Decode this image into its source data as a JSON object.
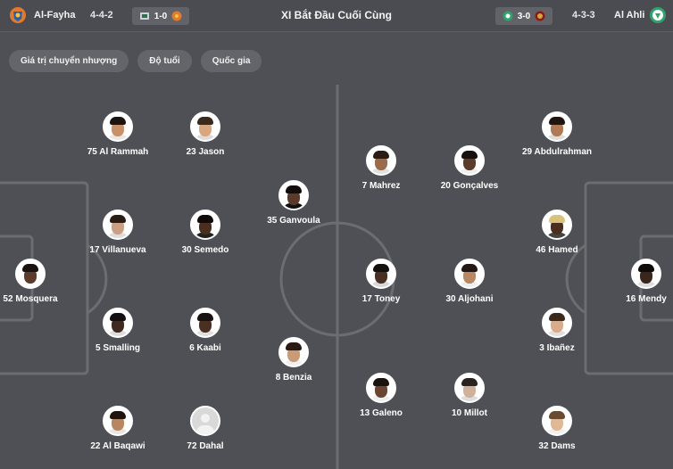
{
  "header": {
    "title": "XI Bắt Đầu Cuối Cùng",
    "home": {
      "name": "Al-Fayha",
      "formation": "4-4-2",
      "last_score": "1-0"
    },
    "away": {
      "name": "Al Ahli",
      "formation": "4-3-3",
      "last_score": "3-0"
    }
  },
  "filters": [
    {
      "label": "Giá trị chuyển nhượng"
    },
    {
      "label": "Độ tuổi"
    },
    {
      "label": "Quốc gia"
    }
  ],
  "colors": {
    "background": "#4e5056",
    "pitch_lines": "#6b6d73",
    "home_logo": "#e07a2e",
    "away_logo": "#2fa36b"
  },
  "lineup": {
    "home": [
      {
        "number": "75",
        "name": "Al Rammah"
      },
      {
        "number": "23",
        "name": "Jason"
      },
      {
        "number": "35",
        "name": "Ganvoula"
      },
      {
        "number": "17",
        "name": "Villanueva"
      },
      {
        "number": "30",
        "name": "Semedo"
      },
      {
        "number": "52",
        "name": "Mosquera"
      },
      {
        "number": "5",
        "name": "Smalling"
      },
      {
        "number": "6",
        "name": "Kaabi"
      },
      {
        "number": "8",
        "name": "Benzia"
      },
      {
        "number": "22",
        "name": "Al Baqawi"
      },
      {
        "number": "72",
        "name": "Dahal"
      }
    ],
    "away": [
      {
        "number": "7",
        "name": "Mahrez"
      },
      {
        "number": "20",
        "name": "Gonçalves"
      },
      {
        "number": "29",
        "name": "Abdulrahman"
      },
      {
        "number": "46",
        "name": "Hamed"
      },
      {
        "number": "17",
        "name": "Toney"
      },
      {
        "number": "30",
        "name": "Aljohani"
      },
      {
        "number": "16",
        "name": "Mendy"
      },
      {
        "number": "3",
        "name": "Ibañez"
      },
      {
        "number": "13",
        "name": "Galeno"
      },
      {
        "number": "10",
        "name": "Millot"
      },
      {
        "number": "32",
        "name": "Dams"
      }
    ]
  }
}
